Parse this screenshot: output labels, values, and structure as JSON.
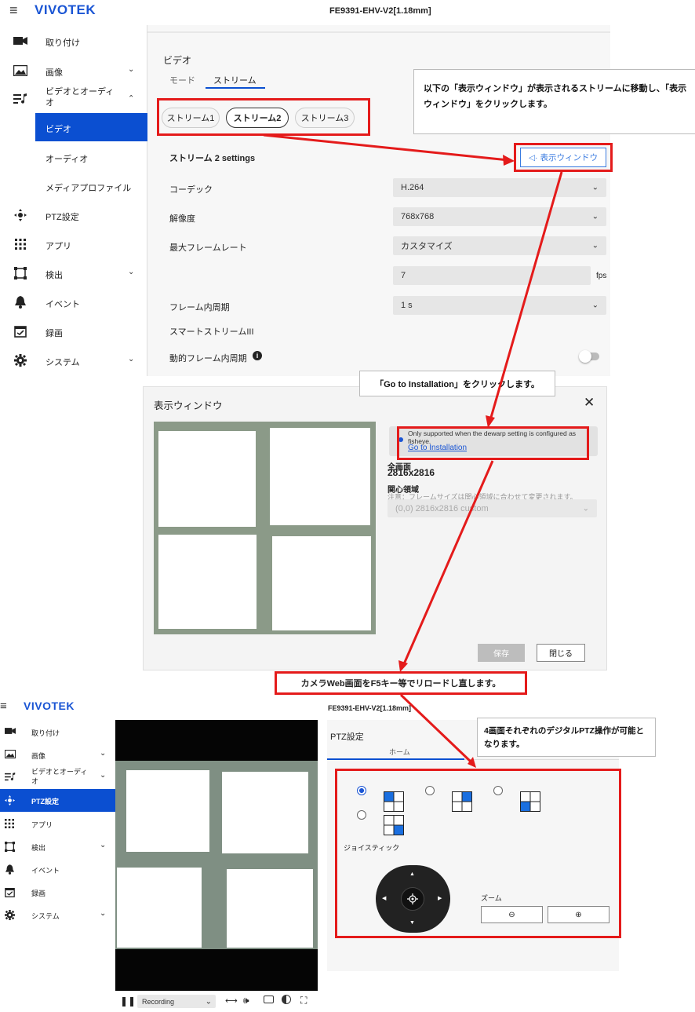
{
  "top": {
    "brand": "VIVOTEK",
    "device_title": "FE9391-EHV-V2[1.18mm]",
    "sidebar": [
      {
        "label": "取り付け",
        "icon": "camera-icon"
      },
      {
        "label": "画像",
        "icon": "image-icon"
      },
      {
        "label": "ビデオとオーディオ",
        "icon": "music-note-icon"
      },
      {
        "label": "ビデオ",
        "icon": ""
      },
      {
        "label": "オーディオ",
        "icon": ""
      },
      {
        "label": "メディアプロファイル",
        "icon": ""
      },
      {
        "label": "PTZ設定",
        "icon": "ptz-icon"
      },
      {
        "label": "アプリ",
        "icon": "apps-grid-icon"
      },
      {
        "label": "検出",
        "icon": "detection-frame-icon"
      },
      {
        "label": "イベント",
        "icon": "bell-icon"
      },
      {
        "label": "録画",
        "icon": "calendar-icon"
      },
      {
        "label": "システム",
        "icon": "gear-icon"
      }
    ],
    "section_title": "ビデオ",
    "tabs": [
      "モード",
      "ストリーム"
    ],
    "stream_buttons": [
      "ストリーム1",
      "ストリーム2",
      "ストリーム3"
    ],
    "settings_title": "ストリーム 2 settings",
    "view_window_button": "表示ウィンドウ",
    "fields": {
      "codec_label": "コーデック",
      "codec_value": "H.264",
      "resolution_label": "解像度",
      "resolution_value": "768x768",
      "max_fps_label": "最大フレームレート",
      "max_fps_value": "カスタマイズ",
      "fps_value": "7",
      "fps_unit": "fps",
      "iframe_label": "フレーム内周期",
      "iframe_value": "1 s",
      "smart_stream_label": "スマートストリームIII",
      "dynamic_iframe_label": "動的フレーム内周期"
    },
    "callout_text": "以下の「表示ウィンドウ」が表示されるストリームに移動し、「表示ウィンドウ」をクリックします。"
  },
  "dialog": {
    "title": "表示ウィンドウ",
    "callout_text": "「Go to Installation」をクリックします。",
    "info_text": "Only supported when the dewarp setting is configured as fisheye.",
    "info_link": "Go to Installation",
    "full_screen_label": "全画面",
    "full_screen_value": "2816x2816",
    "roi_label": "関心領域",
    "roi_note": "注意：フレームサイズは関心領域に合わせて変更されます。",
    "roi_value": "(0,0) 2816x2816 custom",
    "save_button": "保存",
    "close_button": "閉じる"
  },
  "reload_callout": "カメラWeb画面をF5キー等でリロードし直します。",
  "bottom": {
    "brand": "VIVOTEK",
    "device_title": "FE9391-EHV-V2[1.18mm]",
    "sidebar": [
      {
        "label": "取り付け"
      },
      {
        "label": "画像"
      },
      {
        "label": "ビデオとオーディオ"
      },
      {
        "label": "PTZ設定"
      },
      {
        "label": "アプリ"
      },
      {
        "label": "検出"
      },
      {
        "label": "イベント"
      },
      {
        "label": "録画"
      },
      {
        "label": "システム"
      }
    ],
    "ptz_title": "PTZ設定",
    "home_tab": "ホーム",
    "callout_text": "4画面それぞれのデジタルPTZ操作が可能となります。",
    "joystick_label": "ジョイスティック",
    "zoom_label": "ズーム",
    "player_mode": "Recording"
  },
  "colors": {
    "accent": "#0b4fd1",
    "highlight": "#e41b1b",
    "brand": "#1a55d4"
  }
}
